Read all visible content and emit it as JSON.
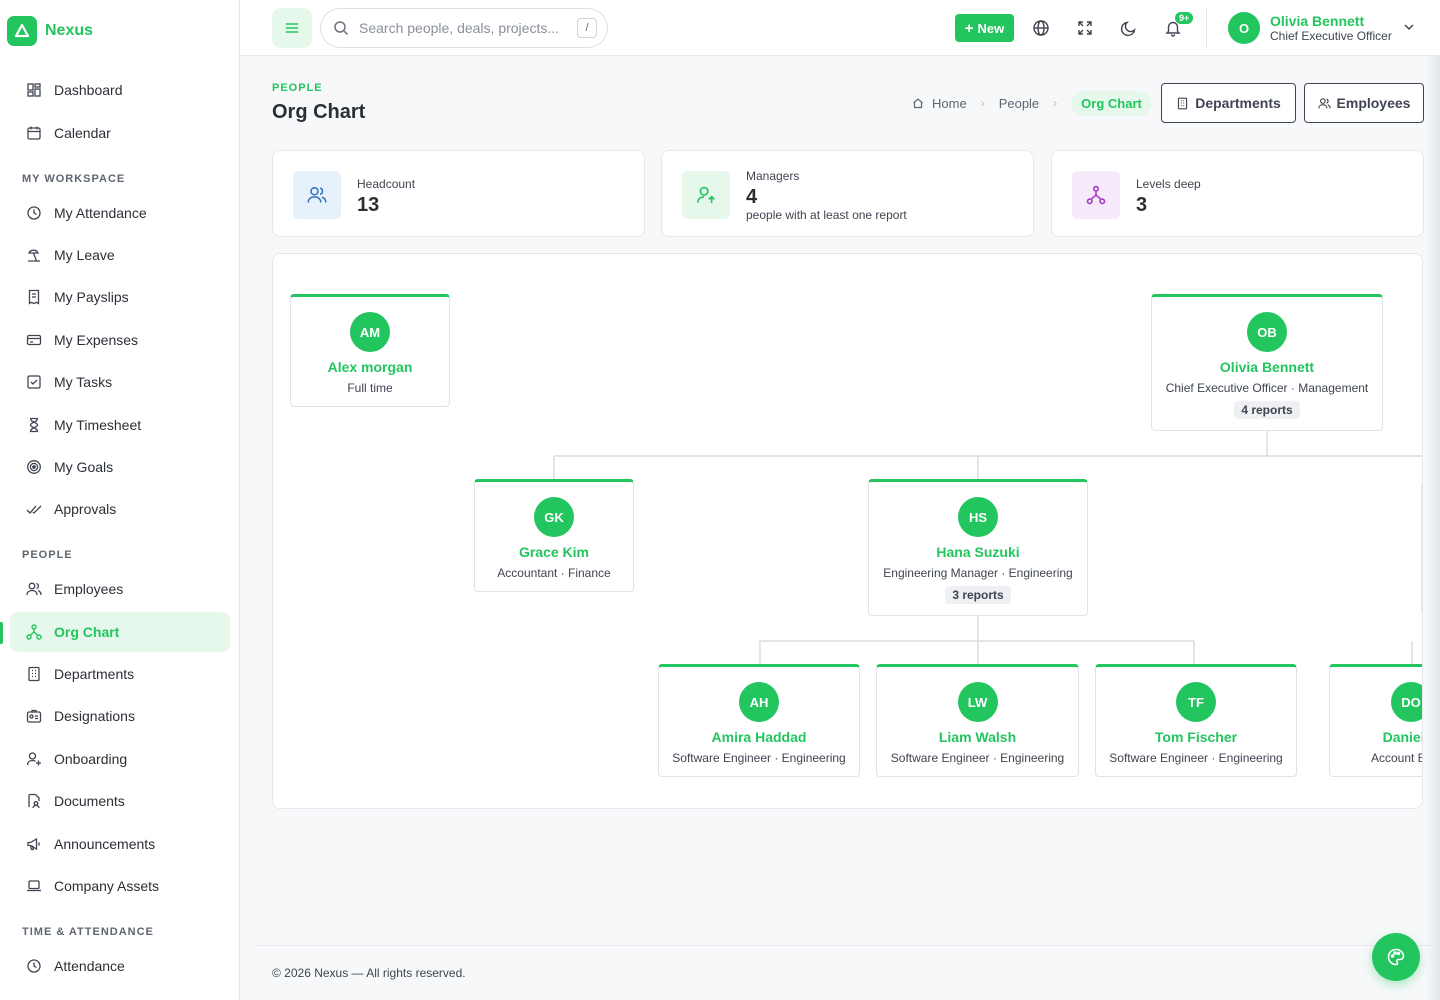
{
  "brand": {
    "name": "Nexus"
  },
  "sidebar": {
    "top_items": [
      {
        "label": "Dashboard"
      },
      {
        "label": "Calendar"
      }
    ],
    "sections": [
      {
        "title": "MY WORKSPACE",
        "items": [
          {
            "label": "My Attendance"
          },
          {
            "label": "My Leave"
          },
          {
            "label": "My Payslips"
          },
          {
            "label": "My Expenses"
          },
          {
            "label": "My Tasks"
          },
          {
            "label": "My Timesheet"
          },
          {
            "label": "My Goals"
          },
          {
            "label": "Approvals"
          }
        ]
      },
      {
        "title": "PEOPLE",
        "items": [
          {
            "label": "Employees"
          },
          {
            "label": "Org Chart",
            "active": true
          },
          {
            "label": "Departments"
          },
          {
            "label": "Designations"
          },
          {
            "label": "Onboarding"
          },
          {
            "label": "Documents"
          },
          {
            "label": "Announcements"
          },
          {
            "label": "Company Assets"
          }
        ]
      },
      {
        "title": "TIME & ATTENDANCE",
        "items": [
          {
            "label": "Attendance"
          }
        ]
      }
    ]
  },
  "topbar": {
    "search_placeholder": "Search people, deals, projects...",
    "search_shortcut": "/",
    "new_label": "New",
    "notifications_badge": "9+",
    "icons": [
      "globe-icon",
      "fullscreen-icon",
      "moon-icon",
      "bell-icon"
    ],
    "user": {
      "initial": "O",
      "name": "Olivia Bennett",
      "role": "Chief Executive Officer"
    }
  },
  "page": {
    "eyebrow": "PEOPLE",
    "title": "Org Chart",
    "breadcrumbs": [
      "Home",
      "People",
      "Org Chart"
    ],
    "buttons": {
      "departments": "Departments",
      "employees": "Employees"
    }
  },
  "stats": [
    {
      "label": "Headcount",
      "value": "13",
      "sub": ""
    },
    {
      "label": "Managers",
      "value": "4",
      "sub": "people with at least one report"
    },
    {
      "label": "Levels deep",
      "value": "3",
      "sub": ""
    }
  ],
  "org": {
    "nodes": [
      {
        "initials": "AM",
        "name": "Alex morgan",
        "role": "Full time",
        "reports": ""
      },
      {
        "initials": "OB",
        "name": "Olivia Bennett",
        "role": "Chief Executive Officer · Management",
        "reports": "4 reports"
      },
      {
        "initials": "GK",
        "name": "Grace Kim",
        "role": "Accountant · Finance",
        "reports": ""
      },
      {
        "initials": "HS",
        "name": "Hana Suzuki",
        "role": "Engineering Manager · Engineering",
        "reports": "3 reports"
      },
      {
        "initials": "AH",
        "name": "Amira Haddad",
        "role": "Software Engineer · Engineering",
        "reports": ""
      },
      {
        "initials": "LW",
        "name": "Liam Walsh",
        "role": "Software Engineer · Engineering",
        "reports": ""
      },
      {
        "initials": "TF",
        "name": "Tom Fischer",
        "role": "Software Engineer · Engineering",
        "reports": ""
      },
      {
        "initials": "DO",
        "name": "Daniel O",
        "role": "Account Execu",
        "reports": ""
      }
    ]
  },
  "footer": {
    "text": "© 2026 Nexus — All rights reserved."
  },
  "colors": {
    "accent": "#22c55e",
    "accent_soft": "#e6f8ec"
  }
}
